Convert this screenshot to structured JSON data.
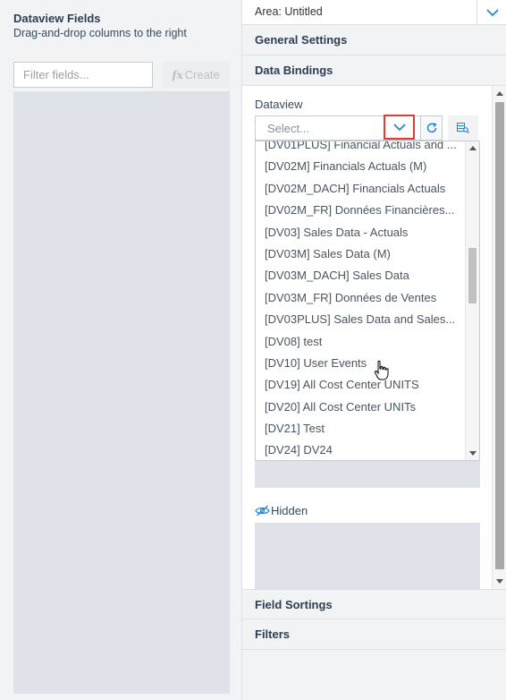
{
  "left_panel": {
    "title": "Dataview Fields",
    "subtitle": "Drag-and-drop columns to the right",
    "filter_placeholder": "Filter fields...",
    "create_label": "Create",
    "create_icon": "fx-icon"
  },
  "right_panel": {
    "area_label": "Area: Untitled",
    "sections": {
      "general_settings": "General Settings",
      "data_bindings": "Data Bindings",
      "field_sortings": "Field Sortings",
      "filters": "Filters"
    },
    "data_bindings": {
      "dataview_label": "Dataview",
      "select_placeholder": "Select...",
      "hidden_label": "Hidden",
      "dropdown_items": [
        "[DV01PLUS] Financial Actuals and ...",
        "[DV02M] Financials Actuals (M)",
        "[DV02M_DACH] Financials Actuals",
        "[DV02M_FR] Données Financières...",
        "[DV03] Sales Data - Actuals",
        "[DV03M] Sales Data (M)",
        "[DV03M_DACH] Sales Data",
        "[DV03M_FR] Données de Ventes",
        "[DV03PLUS] Sales Data and Sales...",
        "[DV08] test",
        "[DV10] User Events",
        "[DV19] All Cost Center UNITS",
        "[DV20] All Cost Center UNITs",
        "[DV21] Test",
        "[DV24] DV24"
      ]
    }
  },
  "colors": {
    "header_text": "#2c3e50",
    "accent_blue": "#1e88e5",
    "highlight_red": "#e53935",
    "panel_gray": "#f2f3f5",
    "dropzone_gray": "#dfe2e8"
  }
}
